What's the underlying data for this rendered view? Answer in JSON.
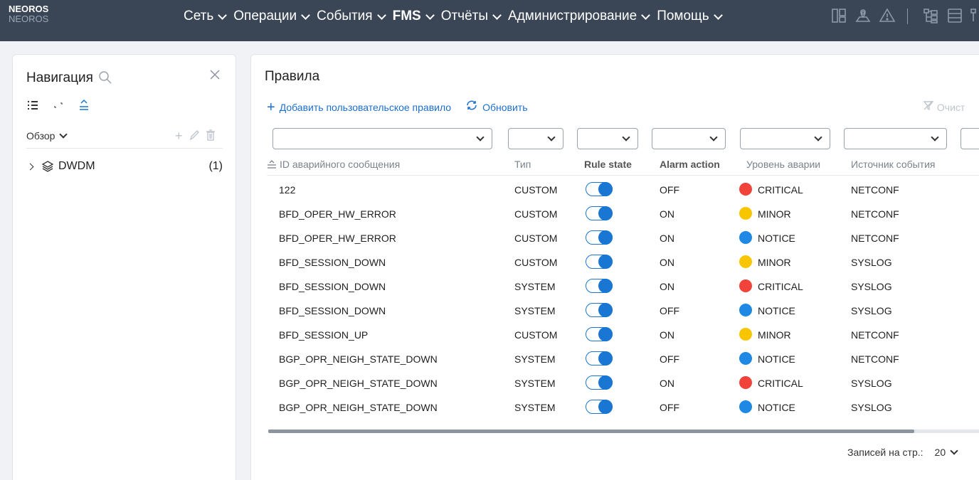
{
  "header": {
    "brand_line1": "NEOROS",
    "brand_line2": "NEOROS",
    "menu": [
      {
        "label": "Сеть",
        "bold": false
      },
      {
        "label": "Операции",
        "bold": false
      },
      {
        "label": "События",
        "bold": false
      },
      {
        "label": "FMS",
        "bold": true
      },
      {
        "label": "Отчёты",
        "bold": false
      },
      {
        "label": "Администрирование",
        "bold": false
      },
      {
        "label": "Помощь",
        "bold": false
      }
    ],
    "icons": [
      "dashboard-icon",
      "map-icon",
      "alert-icon",
      "topology-icon",
      "list-icon",
      "more-icon"
    ]
  },
  "navigation": {
    "title": "Навигация",
    "overview_label": "Обзор",
    "tree": [
      {
        "label": "DWDM",
        "count": "(1)"
      }
    ]
  },
  "rules": {
    "title": "Правила",
    "add_label": "Добавить пользовательское правило",
    "refresh_label": "Обновить",
    "clear_label": "Очист",
    "columns": [
      "ID аварийного сообщения",
      "Тип",
      "Rule state",
      "Alarm action",
      "Уровень аварии",
      "Источник события"
    ],
    "rows": [
      {
        "id": "122",
        "type": "CUSTOM",
        "state": true,
        "action": "OFF",
        "level": "CRITICAL",
        "source": "NETCONF"
      },
      {
        "id": "BFD_OPER_HW_ERROR",
        "type": "CUSTOM",
        "state": true,
        "action": "ON",
        "level": "MINOR",
        "source": "NETCONF"
      },
      {
        "id": "BFD_OPER_HW_ERROR",
        "type": "CUSTOM",
        "state": true,
        "action": "ON",
        "level": "NOTICE",
        "source": "NETCONF"
      },
      {
        "id": "BFD_SESSION_DOWN",
        "type": "CUSTOM",
        "state": true,
        "action": "ON",
        "level": "MINOR",
        "source": "SYSLOG"
      },
      {
        "id": "BFD_SESSION_DOWN",
        "type": "SYSTEM",
        "state": true,
        "action": "ON",
        "level": "CRITICAL",
        "source": "SYSLOG"
      },
      {
        "id": "BFD_SESSION_DOWN",
        "type": "SYSTEM",
        "state": true,
        "action": "OFF",
        "level": "NOTICE",
        "source": "SYSLOG"
      },
      {
        "id": "BFD_SESSION_UP",
        "type": "CUSTOM",
        "state": true,
        "action": "ON",
        "level": "MINOR",
        "source": "NETCONF"
      },
      {
        "id": "BGP_OPR_NEIGH_STATE_DOWN",
        "type": "SYSTEM",
        "state": true,
        "action": "OFF",
        "level": "NOTICE",
        "source": "NETCONF"
      },
      {
        "id": "BGP_OPR_NEIGH_STATE_DOWN",
        "type": "SYSTEM",
        "state": true,
        "action": "ON",
        "level": "CRITICAL",
        "source": "SYSLOG"
      },
      {
        "id": "BGP_OPR_NEIGH_STATE_DOWN",
        "type": "SYSTEM",
        "state": true,
        "action": "OFF",
        "level": "NOTICE",
        "source": "SYSLOG"
      }
    ],
    "level_colors": {
      "CRITICAL": "#f0443a",
      "MINOR": "#f7c600",
      "NOTICE": "#1e88e5"
    },
    "accent_color": "#1976d2",
    "pager_label": "Записей на стр.:",
    "pager_value": "20"
  }
}
